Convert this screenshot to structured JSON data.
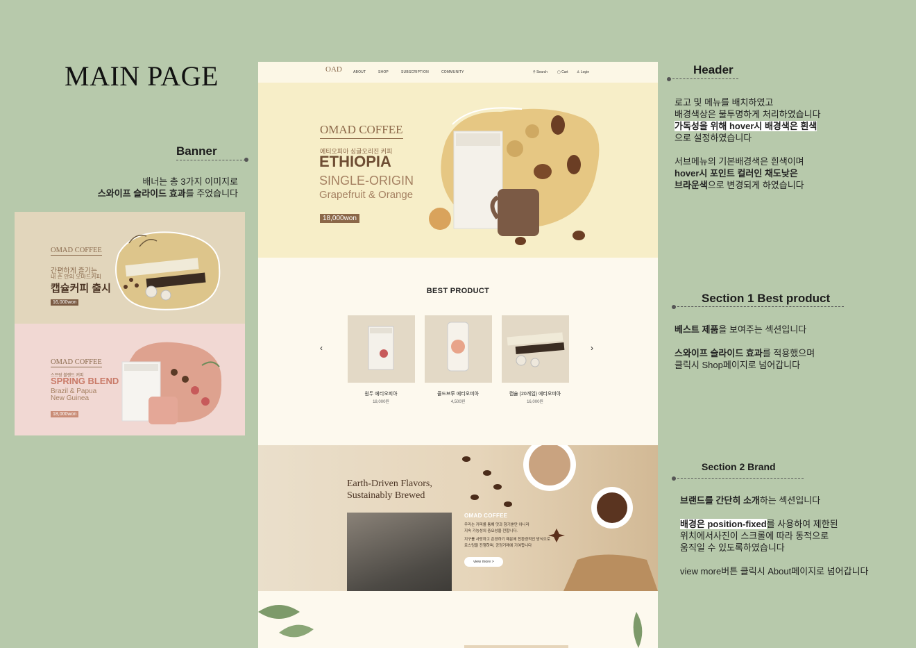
{
  "page_title": "MAIN PAGE",
  "annotations": {
    "header": {
      "title": "Header",
      "lines": [
        "로고 및 메뉴를 배치하였고",
        "배경색상은 불투명하게 처리하였습니다"
      ],
      "highlight": "가독성을 위해 hover시 배경색은 흰색",
      "line_after": "으로 설정하였습니다",
      "sub_1": "서브메뉴의 기본배경색은 흰색이며",
      "sub_2_bold": "hover시 포인트 컬러인 채도낮은",
      "sub_3_bold": "브라운색",
      "sub_3_rest": "으로 변경되게 하였습니다"
    },
    "banner": {
      "title": "Banner",
      "line1": "배너는 총 3가지 이미지로",
      "line2_bold": "스와이프 슬라이드 효과",
      "line2_rest": "를 주었습니다"
    },
    "section1": {
      "title": "Section 1   Best product",
      "l1_bold": "베스트 제품",
      "l1_rest": "을 보여주는 섹션입니다",
      "l2_bold": "스와이프 슬라이드 효과",
      "l2_rest": "를 적용했으며",
      "l3": "클릭시 Shop페이지로 넘어갑니다"
    },
    "section2": {
      "title": "Section 2   Brand",
      "l1_bold": "브랜드를 간단히 소개",
      "l1_rest": "하는 섹션입니다",
      "l2_hl": "배경은 position-fixed",
      "l2_rest": "를 사용하여 제한된",
      "l3": "위치에서사진이 스크롤에 따라 동적으로",
      "l4": "움직일 수 있도록하였습니다",
      "l5": "view more버튼 클릭시 About페이지로 넘어갑니다"
    }
  },
  "banner_samples": [
    {
      "brand": "OMAD COFFEE",
      "line1": "간편하게 즐기는",
      "line2": "내 손 안의 오마드커피",
      "big": "캡슐커피 출시",
      "price": "16,000won"
    },
    {
      "brand": "OMAD COFFEE",
      "line1": "스프링 블렌드 커피",
      "big": "SPRING BLEND",
      "sub1": "Brazil & Papua",
      "sub2": "New Guinea",
      "price": "18,000won"
    }
  ],
  "mockup": {
    "logo": "OAD",
    "nav": [
      "ABOUT",
      "SHOP",
      "SUBSCRIPTION",
      "COMMUNITY"
    ],
    "util": {
      "search": "Search",
      "cart": "Cart",
      "login": "Login"
    },
    "banner": {
      "brand": "OMAD COFFEE",
      "sub": "에티오피아 싱글오리진 커피",
      "title": "ETHIOPIA",
      "origin": "SINGLE-ORIGIN",
      "flavor": "Grapefruit & Orange",
      "price": "18,000won"
    },
    "best": {
      "title": "BEST PRODUCT",
      "prev": "‹",
      "next": "›",
      "products": [
        {
          "name": "원두 에티오피아",
          "price": "18,000원"
        },
        {
          "name": "콜드브루 에티오피아",
          "price": "4,500원"
        },
        {
          "name": "캡슐 (20개입) 에티오피아",
          "price": "16,000원"
        }
      ]
    },
    "brand": {
      "title1": "Earth-Driven Flavors,",
      "title2": "Sustainably Brewed",
      "label": "OMAD COFFEE",
      "lines": [
        "우리는 커피를 통해 맛과 향기뿐만 아니라",
        "지속 가능성의 중요성을 전합니다.",
        "지구를 사랑하고 존경하기 때문에 친환경적인 방식으로",
        "로스팅을 진행하며, 공정거래에 기여합니다"
      ],
      "button": "view more >"
    }
  },
  "colors": {
    "background": "#b7c9ab",
    "brown": "#8b6748",
    "banner_bg": "#f7eec8",
    "cream": "#fdf9ee"
  }
}
